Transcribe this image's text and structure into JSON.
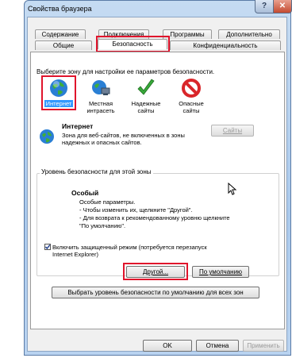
{
  "window": {
    "title": "Свойства браузера"
  },
  "tabs_back": [
    "Содержание",
    "Подключения",
    "Программы",
    "Дополнительно"
  ],
  "tabs_front": [
    "Общие",
    "Безопасность",
    "Конфиденциальность"
  ],
  "zone_prompt": "Выберите зону для настройки ее параметров безопасности.",
  "zones": [
    {
      "line1": "Интернет",
      "line2": "",
      "icon": "globe-icon"
    },
    {
      "line1": "Местная",
      "line2": "интрасеть",
      "icon": "intranet-icon"
    },
    {
      "line1": "Надежные",
      "line2": "сайты",
      "icon": "check-icon"
    },
    {
      "line1": "Опасные",
      "line2": "сайты",
      "icon": "forbidden-icon"
    }
  ],
  "zone_info": {
    "title": "Интернет",
    "desc_1": "Зона для веб-сайтов, не включенных в зоны",
    "desc_2": "надежных и опасных сайтов.",
    "sites_button": "Сайты"
  },
  "security_level": {
    "legend": "Уровень безопасности для этой зоны",
    "level_title": "Особый",
    "lines": [
      "Особые параметры.",
      "- Чтобы изменить их, щелкните \"Другой\".",
      "- Для возврата к рекомендованному уровню щелкните",
      "\"По умолчанию\"."
    ]
  },
  "protected_mode": {
    "checked": true,
    "line1": "Включить защищенный режим (потребуется перезапуск",
    "line2": "Internet Explorer)"
  },
  "buttons": {
    "other": "Другой...",
    "default": "По умолчанию",
    "reset_all": "Выбрать уровень безопасности по умолчанию для всех зон",
    "ok": "OK",
    "cancel": "Отмена",
    "apply": "Применить"
  },
  "colors": {
    "highlight": "#e0142c",
    "selection": "#3399ff",
    "title_bar": "#aac9ec"
  }
}
